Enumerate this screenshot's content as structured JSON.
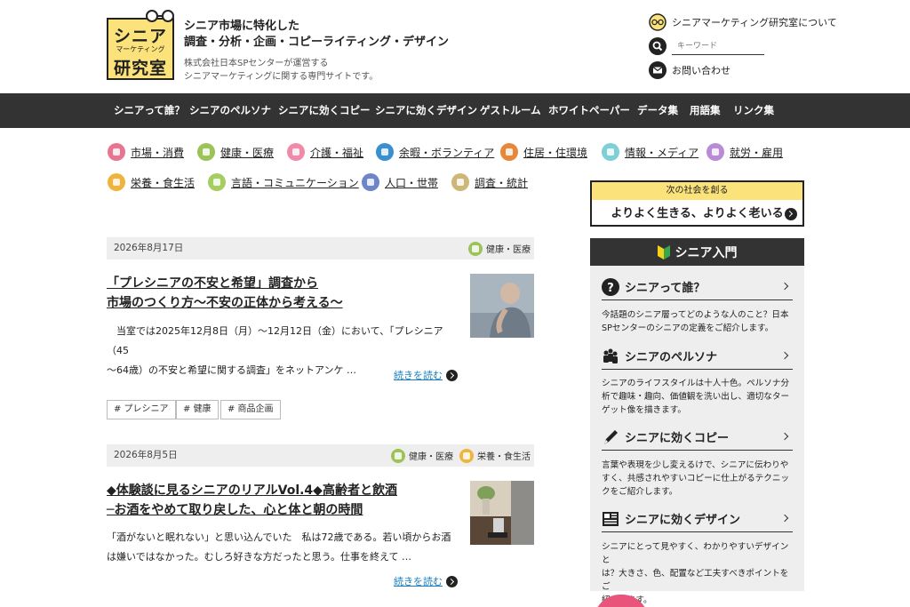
{
  "header": {
    "logo": {
      "line1": "シニア",
      "line2": "マーケティング",
      "line3": "研究室"
    },
    "tagline1": "シニア市場に特化した",
    "tagline2": "調査・分析・企画・コピーライティング・デザイン",
    "company1": "株式会社日本SPセンターが運営する",
    "company2": "シニアマーケティングに関する専門サイトです。",
    "about_link": "シニアマーケティング研究室について",
    "search_placeholder": "キーワード",
    "contact_link": "お問い合わせ"
  },
  "nav": [
    "シニアって誰？",
    "シニアのペルソナ",
    "シニアに効くコピー",
    "シニアに効くデザイン",
    "ゲストルーム",
    "ホワイトペーパー",
    "データ集",
    "用語集",
    "リンク集"
  ],
  "categories": [
    {
      "label": "市場・消費",
      "color": "#e9748f"
    },
    {
      "label": "健康・医療",
      "color": "#9cc35a"
    },
    {
      "label": "介護・福祉",
      "color": "#f08aa8"
    },
    {
      "label": "余暇・ボランティア",
      "color": "#3a8fd0"
    },
    {
      "label": "住居・住環境",
      "color": "#e8873a"
    },
    {
      "label": "情報・メディア",
      "color": "#7fcfd6"
    },
    {
      "label": "就労・雇用",
      "color": "#b98ad8"
    },
    {
      "label": "栄養・食生活",
      "color": "#f2b33d"
    },
    {
      "label": "言語・コミュニケーション",
      "color": "#a6cd62"
    },
    {
      "label": "人口・世帯",
      "color": "#6d86c9"
    },
    {
      "label": "調査・統計",
      "color": "#cdb778"
    }
  ],
  "articles": [
    {
      "date": "2026年8月17日",
      "cats": [
        {
          "label": "健康・医療",
          "color": "#9cc35a"
        }
      ],
      "title1": "「プレシニアの不安と希望」調査から",
      "title2": "市場のつくり方〜不安の正体から考える〜",
      "excerpt1": "　当室では2025年12月8日（月）〜12月12日（金）において、「プレシニア（45",
      "excerpt2": "〜64歳）の不安と希望に関する調査」をネットアンケ …",
      "readmore": "続きを読む",
      "tags": [
        "# プレシニア",
        "# 健康",
        "# 商品企画"
      ]
    },
    {
      "date": "2026年8月5日",
      "cats": [
        {
          "label": "健康・医療",
          "color": "#9cc35a"
        },
        {
          "label": "栄養・食生活",
          "color": "#f2b33d"
        }
      ],
      "title1": "◆体験談に見るシニアのリアルVol.4◆高齢者と飲酒",
      "title2": "─お酒をやめて取り戻した、心と体と朝の時間",
      "excerpt1": "「酒がないと眠れない」と思い込んでいた　私は72歳である。若い頃からお酒",
      "excerpt2": "は嫌いではなかった。むしろ好きな方だったと思う。仕事を終えて …",
      "readmore": "続きを読む"
    }
  ],
  "sidebar": {
    "banner_top": "次の社会を創る",
    "banner_main": "よりよく生きる、よりよく老いる",
    "heading": "シニア入門",
    "items": [
      {
        "title": "シニアって誰？",
        "icon": "question-icon",
        "desc1": "今話題のシニア層ってどのような人のこと？日本",
        "desc2": "SPセンターのシニアの定義をご紹介します。"
      },
      {
        "title": "シニアのペルソナ",
        "icon": "people-icon",
        "desc1": "シニアのライフスタイルは十人十色。ペルソナ分",
        "desc2": "析で趣味・趣向、価値観を洗い出し、適切なター",
        "desc3": "ゲット像を描きます。"
      },
      {
        "title": "シニアに効くコピー",
        "icon": "pen-icon",
        "desc1": "言葉や表現を少し変えるけで、シニアに伝わりや",
        "desc2": "すく、共感されやすいコピーに仕上がるテクニッ",
        "desc3": "クをご紹介します。"
      },
      {
        "title": "シニアに効くデザイン",
        "icon": "layout-icon",
        "desc1": "シニアにとって見やすく、わかりやすいデザインと",
        "desc2": "は？大きさ、色、配置など工夫すべきポイントをご",
        "desc3": "紹介します。"
      }
    ]
  }
}
